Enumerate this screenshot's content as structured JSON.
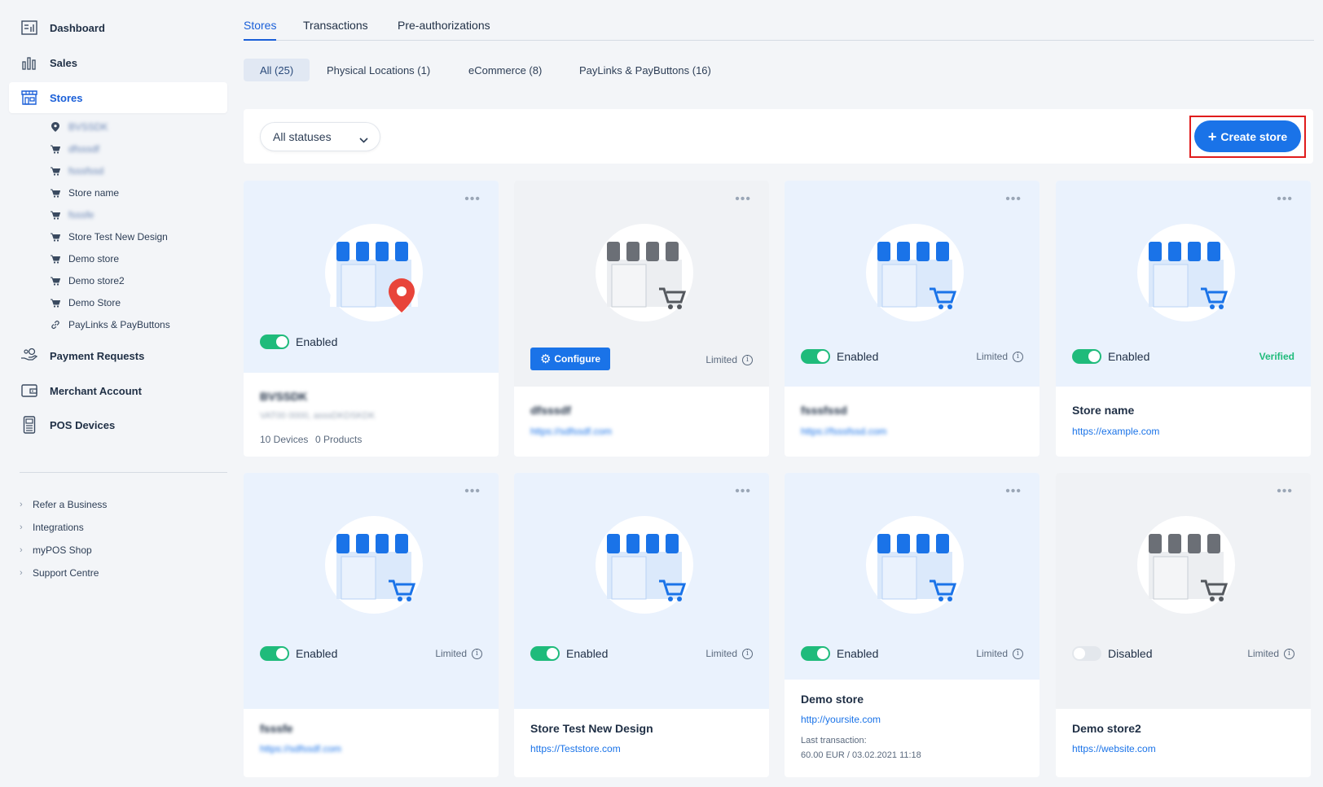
{
  "sidebar": {
    "nav": [
      {
        "label": "Dashboard",
        "icon": "dashboard-icon"
      },
      {
        "label": "Sales",
        "icon": "bar-chart-icon"
      },
      {
        "label": "Stores",
        "icon": "storefront-icon"
      },
      {
        "label": "Payment Requests",
        "icon": "hand-money-icon"
      },
      {
        "label": "Merchant Account",
        "icon": "wallet-icon"
      },
      {
        "label": "POS Devices",
        "icon": "pos-terminal-icon"
      }
    ],
    "stores": [
      {
        "label": "BVSSDK",
        "icon": "location-pin-icon",
        "blurred": true
      },
      {
        "label": "dfsssdf",
        "icon": "cart-icon",
        "blurred": true
      },
      {
        "label": "fsssfssd",
        "icon": "cart-icon",
        "blurred": true
      },
      {
        "label": "Store name",
        "icon": "cart-icon",
        "blurred": false
      },
      {
        "label": "fsssfe",
        "icon": "cart-icon",
        "blurred": true
      },
      {
        "label": "Store Test New Design",
        "icon": "cart-icon",
        "blurred": false
      },
      {
        "label": "Demo store",
        "icon": "cart-icon",
        "blurred": false
      },
      {
        "label": "Demo store2",
        "icon": "cart-icon",
        "blurred": false
      },
      {
        "label": "Demo Store",
        "icon": "cart-icon",
        "blurred": false
      },
      {
        "label": "PayLinks & PayButtons",
        "icon": "link-icon",
        "blurred": false
      }
    ],
    "footer": [
      "Refer a Business",
      "Integrations",
      "myPOS Shop",
      "Support Centre"
    ]
  },
  "tabs": [
    "Stores",
    "Transactions",
    "Pre-authorizations"
  ],
  "filters": [
    "All (25)",
    "Physical Locations (1)",
    "eCommerce (8)",
    "PayLinks & PayButtons (16)"
  ],
  "toolbar": {
    "status_select": "All statuses",
    "create_label": "Create store"
  },
  "cards": [
    {
      "kind": "physical",
      "status": "Enabled",
      "enabled": true,
      "note": "",
      "name": "BVSSDK",
      "url": "",
      "subline": "VAT00 0000, asssDKDSKDK",
      "meta_devices": "10 Devices",
      "meta_products": "0 Products",
      "blurred": true
    },
    {
      "kind": "ecommerce-grey",
      "status": "",
      "enabled": false,
      "configure": "Configure",
      "note": "Limited",
      "name": "dfsssdf",
      "url": "https://sdfssdf.com",
      "blurred": true
    },
    {
      "kind": "ecommerce",
      "status": "Enabled",
      "enabled": true,
      "note": "Limited",
      "name": "fsssfssd",
      "url": "https://fsssfssd.com",
      "blurred": true
    },
    {
      "kind": "ecommerce",
      "status": "Enabled",
      "enabled": true,
      "note": "Verified",
      "name": "Store name",
      "url": "https://example.com",
      "blurred": false
    },
    {
      "kind": "ecommerce",
      "status": "Enabled",
      "enabled": true,
      "note": "Limited",
      "name": "fsssfe",
      "url": "https://sdfssdf.com",
      "blurred": true
    },
    {
      "kind": "ecommerce",
      "status": "Enabled",
      "enabled": true,
      "note": "Limited",
      "name": "Store Test New Design",
      "url": "https://Teststore.com",
      "blurred": false
    },
    {
      "kind": "ecommerce",
      "status": "Enabled",
      "enabled": true,
      "note": "Limited",
      "name": "Demo store",
      "url": "http://yoursite.com",
      "last_label": "Last transaction:",
      "last_value": "60.00 EUR / 03.02.2021 11:18",
      "blurred": false
    },
    {
      "kind": "ecommerce-grey",
      "status": "Disabled",
      "enabled": false,
      "note": "Limited",
      "name": "Demo store2",
      "url": "https://website.com",
      "blurred": false
    }
  ],
  "colors": {
    "accent": "#1a73e8",
    "toggle_on": "#1fbb7b",
    "highlight": "#e01c1c",
    "card_top_blue": "#eaf2fd",
    "card_top_grey": "#f0f2f5"
  }
}
